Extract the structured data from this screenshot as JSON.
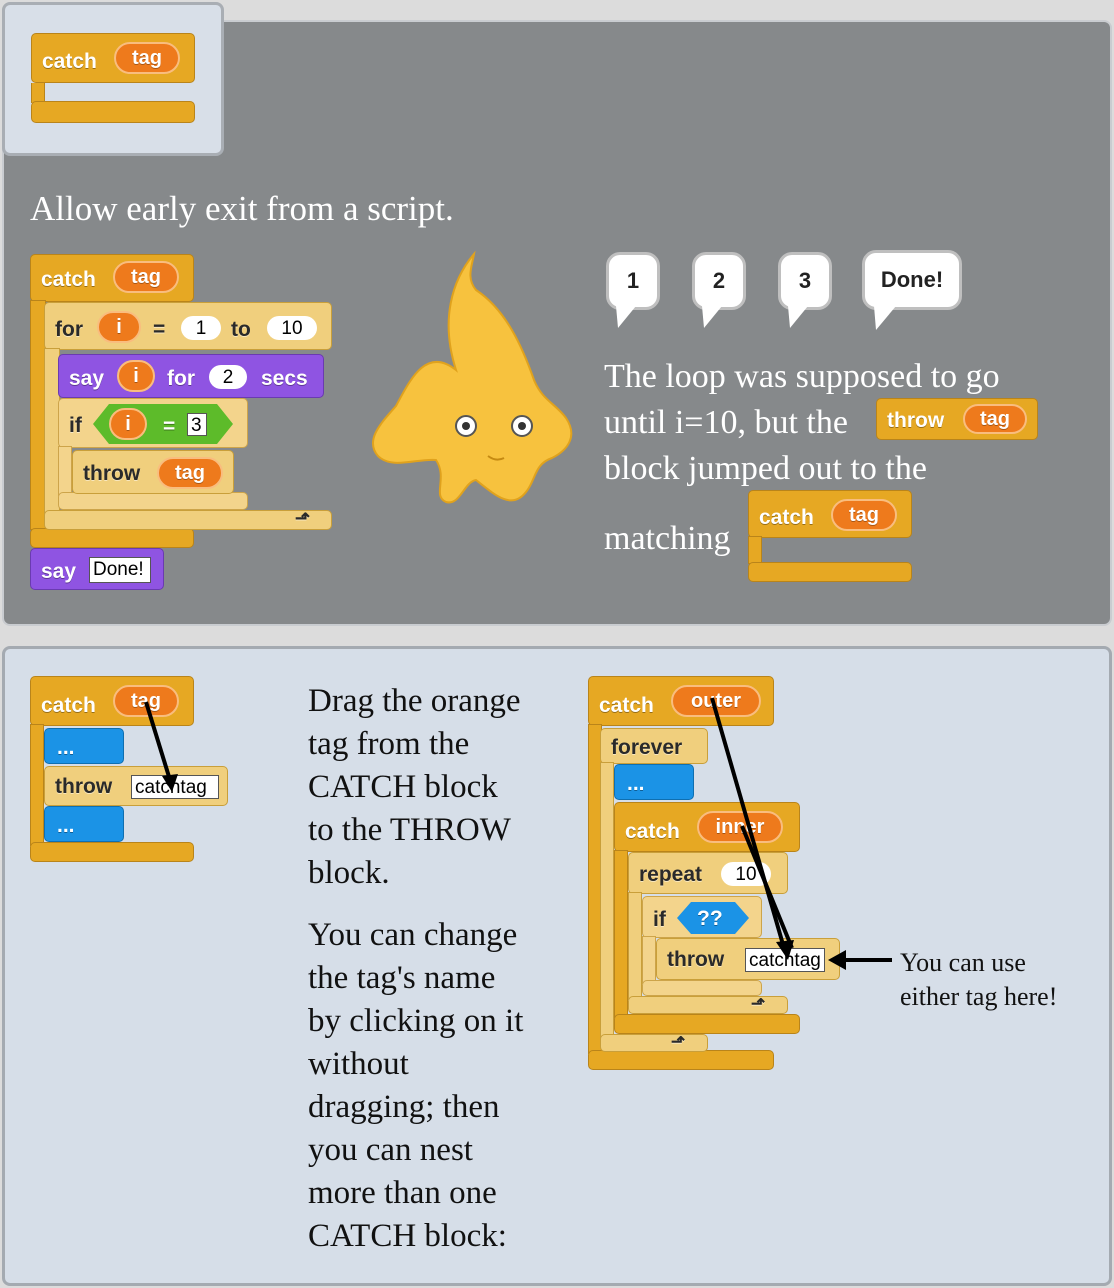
{
  "palette_block": {
    "catch_label": "catch",
    "tag_label": "tag"
  },
  "description": "Allow early exit from a script.",
  "example_script": {
    "catch_label": "catch",
    "tag_label": "tag",
    "for_label": "for",
    "var_i": "i",
    "equals": "=",
    "from_value": "1",
    "to_label": "to",
    "to_value": "10",
    "say_label": "say",
    "say_var": "i",
    "say_for": "for",
    "say_secs_value": "2",
    "secs_label": "secs",
    "if_label": "if",
    "cond_var": "i",
    "cond_eq": "=",
    "cond_value": "3",
    "throw_label": "throw",
    "throw_tag": "tag",
    "final_say_label": "say",
    "final_say_value": "Done!"
  },
  "speech_bubbles": [
    "1",
    "2",
    "3",
    "Done!"
  ],
  "explanation": {
    "line1": "The loop was supposed to go",
    "line2_start": "until i=10, but the",
    "inline_throw": "throw",
    "inline_throw_tag": "tag",
    "line3": "block jumped out to the",
    "line4": "matching",
    "inline_catch": "catch",
    "inline_catch_tag": "tag"
  },
  "drag_demo": {
    "catch_label": "catch",
    "tag_label": "tag",
    "placeholder1": "...",
    "throw_label": "throw",
    "throw_value": "catchtag",
    "placeholder2": "..."
  },
  "instructions": {
    "drag_text": [
      "Drag the orange",
      "tag from the",
      "CATCH block",
      "to the THROW",
      "block."
    ],
    "rename_text": [
      "You can change",
      "the tag's name",
      "by clicking on it",
      "without",
      "dragging; then",
      "you can nest",
      "more than one",
      "CATCH block:"
    ]
  },
  "nested_demo": {
    "outer_catch": "catch",
    "outer_tag": "outer",
    "forever_label": "forever",
    "placeholder": "...",
    "inner_catch": "catch",
    "inner_tag": "inner",
    "repeat_label": "repeat",
    "repeat_value": "10",
    "if_label": "if",
    "cond": "??",
    "throw_label": "throw",
    "throw_value": "catchtag"
  },
  "annotation": {
    "line1": "You can use",
    "line2": "either tag here!"
  },
  "colors": {
    "control": "#e6a823",
    "looks": "#8f54e2",
    "variable": "#ee7a1c",
    "custom": "#1b93e6",
    "operator": "#5dbb2a"
  }
}
